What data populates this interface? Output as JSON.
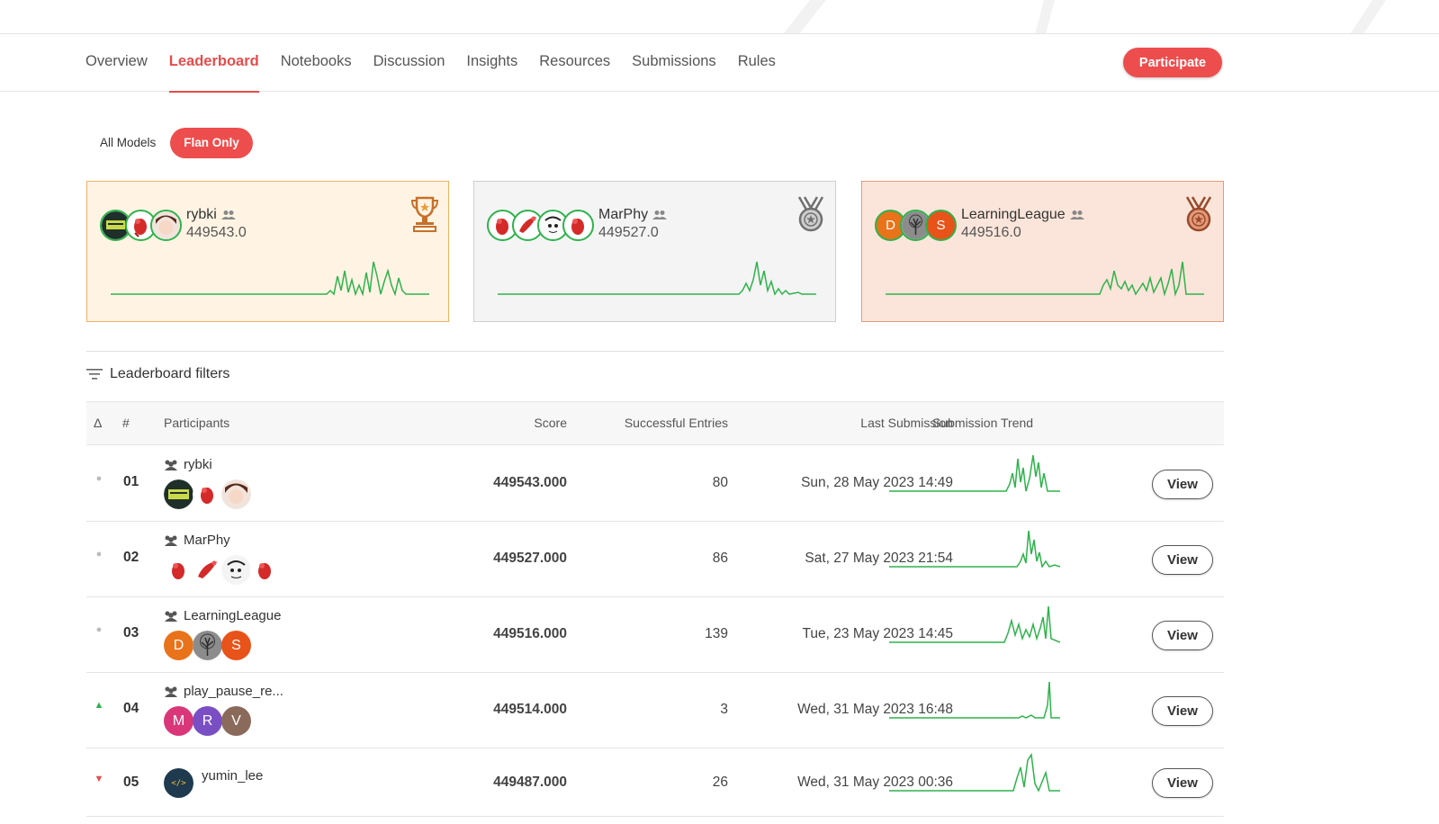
{
  "tabs": [
    {
      "label": "Overview"
    },
    {
      "label": "Leaderboard"
    },
    {
      "label": "Notebooks"
    },
    {
      "label": "Discussion"
    },
    {
      "label": "Insights"
    },
    {
      "label": "Resources"
    },
    {
      "label": "Submissions"
    },
    {
      "label": "Rules"
    }
  ],
  "active_tab": "Leaderboard",
  "participate_label": "Participate",
  "toggle": {
    "all_models": "All Models",
    "flan_only": "Flan Only",
    "selected": "Flan Only"
  },
  "podium": [
    {
      "rank": "1",
      "medal": "trophy-icon",
      "team": "rybki",
      "score": "449543.0"
    },
    {
      "rank": "2",
      "medal": "silver-medal-icon",
      "team": "MarPhy",
      "score": "449527.0"
    },
    {
      "rank": "3",
      "medal": "bronze-medal-icon",
      "team": "LearningLeague",
      "score": "449516.0"
    }
  ],
  "filters_label": "Leaderboard filters",
  "table": {
    "headers": {
      "delta": "Δ",
      "rank": "#",
      "participants": "Participants",
      "score": "Score",
      "entries": "Successful Entries",
      "last": "Last Submission",
      "trend": "Submission Trend"
    },
    "rows": [
      {
        "delta": "same",
        "rank": "01",
        "team": "rybki",
        "is_team": true,
        "score": "449543.000",
        "entries": "80",
        "last": "Sun, 28 May 2023 14:49",
        "view": "View"
      },
      {
        "delta": "same",
        "rank": "02",
        "team": "MarPhy",
        "is_team": true,
        "score": "449527.000",
        "entries": "86",
        "last": "Sat, 27 May 2023 21:54",
        "view": "View"
      },
      {
        "delta": "same",
        "rank": "03",
        "team": "LearningLeague",
        "is_team": true,
        "score": "449516.000",
        "entries": "139",
        "last": "Tue, 23 May 2023 14:45",
        "view": "View"
      },
      {
        "delta": "up",
        "rank": "04",
        "team": "play_pause_re...",
        "is_team": true,
        "score": "449514.000",
        "entries": "3",
        "last": "Wed, 31 May 2023 16:48",
        "view": "View"
      },
      {
        "delta": "down",
        "rank": "05",
        "team": "yumin_lee",
        "is_team": false,
        "score": "449487.000",
        "entries": "26",
        "last": "Wed, 31 May 2023 00:36",
        "view": "View"
      }
    ]
  },
  "avatar_letters": {
    "learningleague": [
      "D",
      "",
      "S"
    ],
    "play_pause": [
      "M",
      "R",
      "V"
    ]
  },
  "colors": {
    "accent": "#ee4d4d",
    "trend": "#2fb24c",
    "up": "#2fb24c",
    "down": "#e64c4c"
  }
}
